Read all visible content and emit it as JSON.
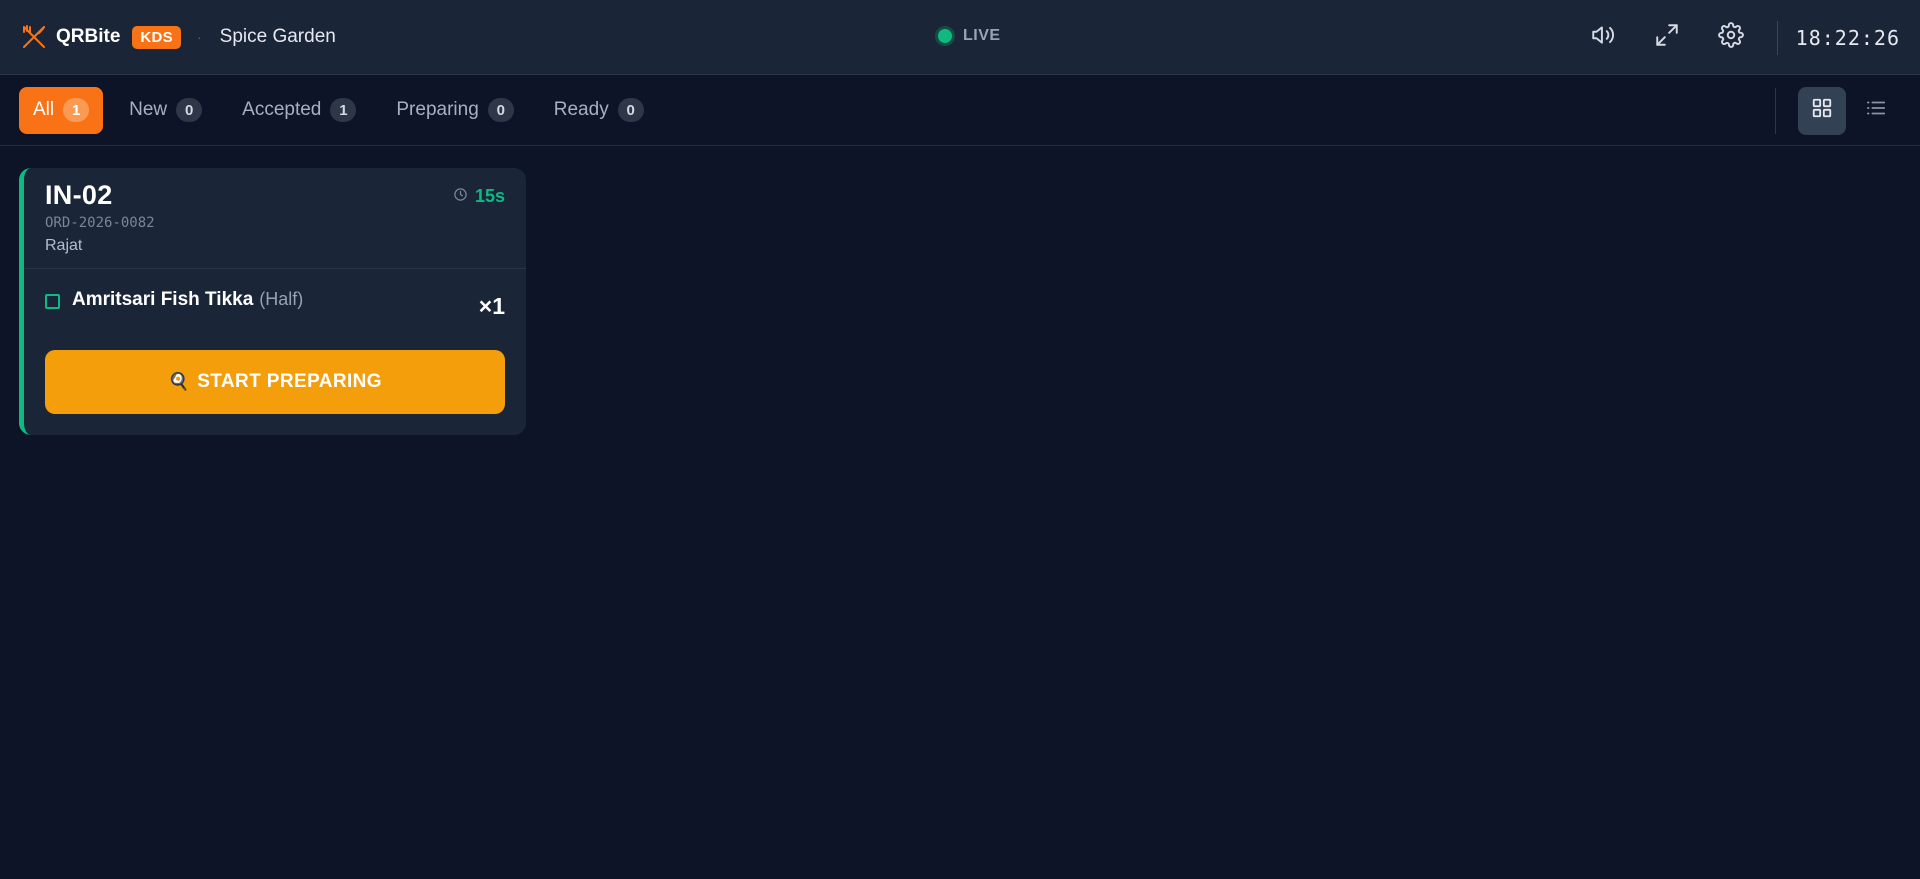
{
  "header": {
    "brand": "QRBite",
    "badge": "KDS",
    "separator": "·",
    "restaurant": "Spice Garden",
    "live_label": "LIVE",
    "clock": "18:22:26"
  },
  "icons": {
    "logo": "fork-knife-icon",
    "sound": "speaker-icon",
    "fullscreen": "expand-icon",
    "settings": "gear-icon",
    "grid_view": "grid-icon",
    "list_view": "list-icon",
    "timer": "clock-icon",
    "start": "frying-pan-icon"
  },
  "filters": [
    {
      "label": "All",
      "count": "1",
      "active": true
    },
    {
      "label": "New",
      "count": "0",
      "active": false
    },
    {
      "label": "Accepted",
      "count": "1",
      "active": false
    },
    {
      "label": "Preparing",
      "count": "0",
      "active": false
    },
    {
      "label": "Ready",
      "count": "0",
      "active": false
    }
  ],
  "orders": [
    {
      "table": "IN-02",
      "order_no": "ORD-2026-0082",
      "customer": "Rajat",
      "elapsed": "15s",
      "items": [
        {
          "name": "Amritsari Fish Tikka",
          "variant": "(Half)",
          "qty": "×1"
        }
      ],
      "action_icon": "🍳",
      "action_label": "START PREPARING"
    }
  ],
  "colors": {
    "accent": "#f97316",
    "action": "#f59e0b",
    "success": "#10b981",
    "background": "#0d1427",
    "panel": "#1b2538"
  }
}
